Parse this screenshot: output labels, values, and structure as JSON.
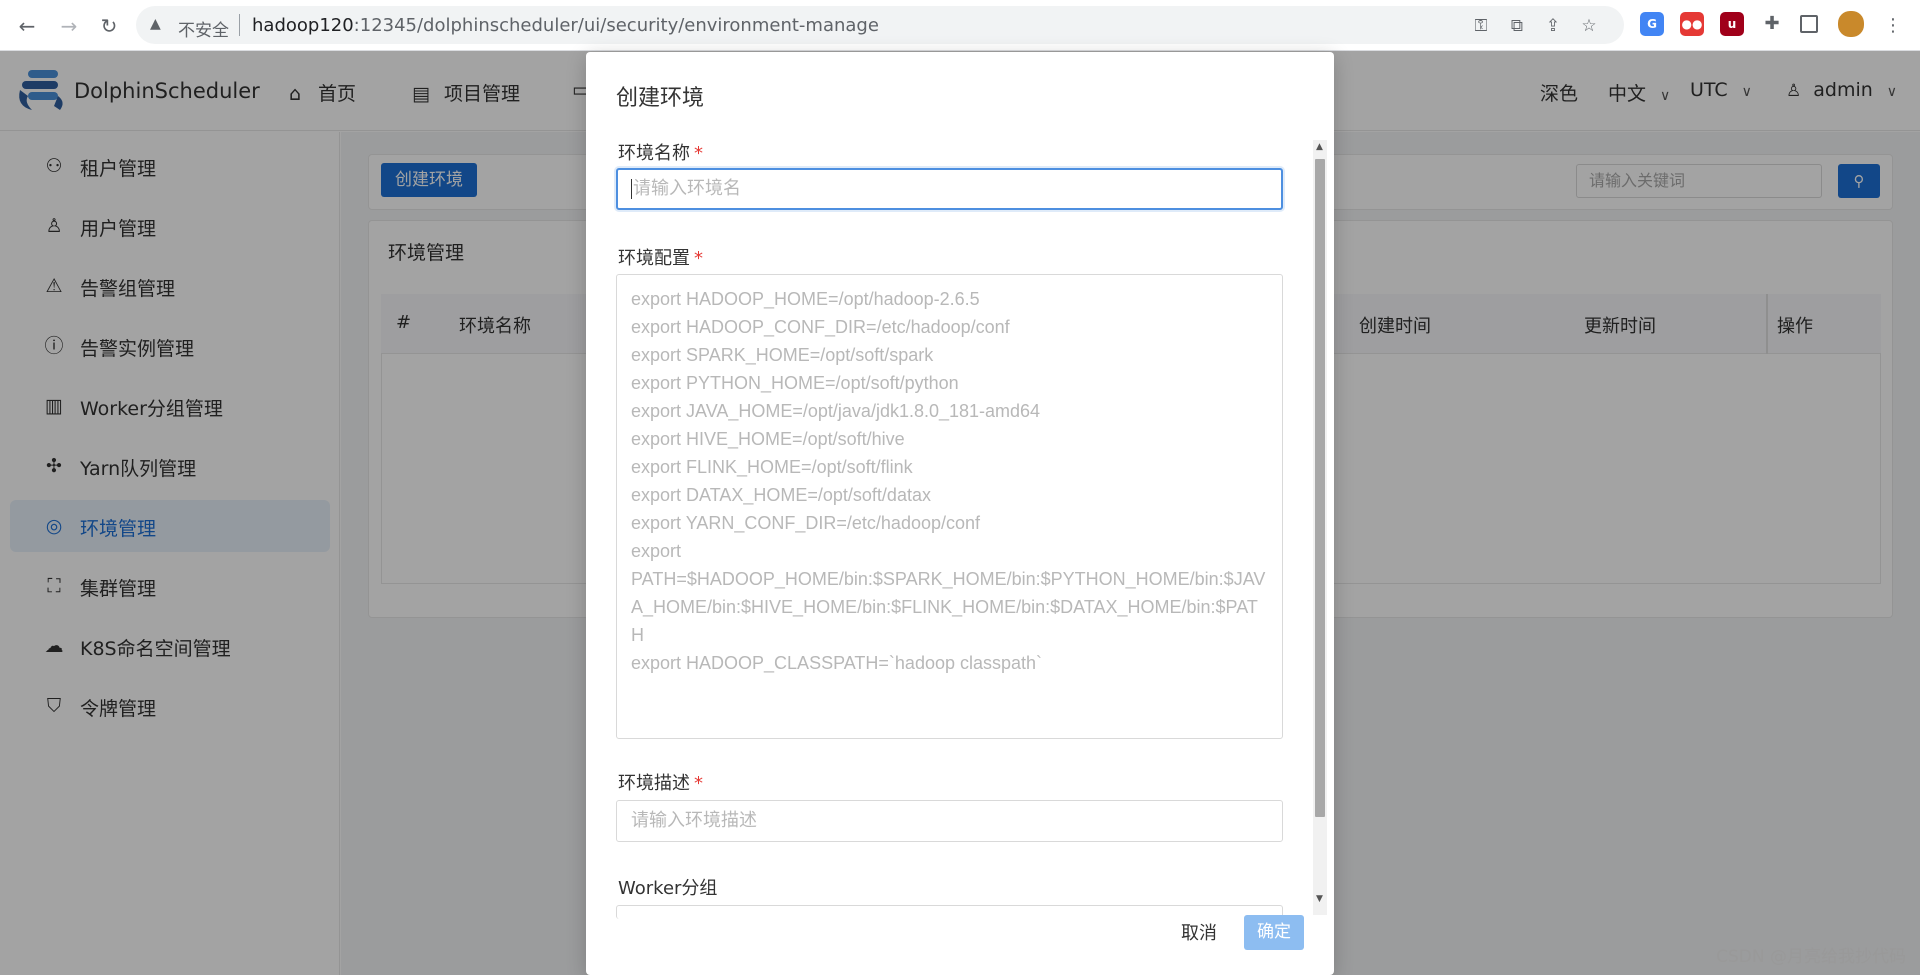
{
  "browser": {
    "back": "←",
    "forward": "→",
    "reload": "↻",
    "insecure_label": "不安全",
    "url_host": "hadoop120",
    "url_rest": ":12345/dolphinscheduler/ui/security/environment-manage"
  },
  "app": {
    "logo_text": "DolphinScheduler",
    "nav": [
      {
        "label": "首页",
        "icon": "home-icon"
      },
      {
        "label": "项目管理",
        "icon": "project-icon"
      }
    ],
    "theme_label": "深色",
    "language_label": "中文",
    "timezone_label": "UTC",
    "user_label": "admin"
  },
  "sidebar": {
    "items": [
      {
        "label": "租户管理",
        "icon": "tenant-icon",
        "active": false
      },
      {
        "label": "用户管理",
        "icon": "user-icon",
        "active": false
      },
      {
        "label": "告警组管理",
        "icon": "warning-icon",
        "active": false
      },
      {
        "label": "告警实例管理",
        "icon": "info-icon",
        "active": false
      },
      {
        "label": "Worker分组管理",
        "icon": "worker-group-icon",
        "active": false
      },
      {
        "label": "Yarn队列管理",
        "icon": "yarn-icon",
        "active": false
      },
      {
        "label": "环境管理",
        "icon": "location-icon",
        "active": true
      },
      {
        "label": "集群管理",
        "icon": "cluster-icon",
        "active": false
      },
      {
        "label": "K8S命名空间管理",
        "icon": "k8s-icon",
        "active": false
      },
      {
        "label": "令牌管理",
        "icon": "shield-icon",
        "active": false
      }
    ]
  },
  "main": {
    "create_button": "创建环境",
    "search_placeholder": "请输入关键词",
    "card_title": "环境管理",
    "table_headers": [
      "#",
      "环境名称",
      "创建时间",
      "更新时间",
      "操作"
    ]
  },
  "modal": {
    "title": "创建环境",
    "name_label": "环境名称",
    "name_placeholder": "请输入环境名",
    "config_label": "环境配置",
    "config_lines": [
      "export HADOOP_HOME=/opt/hadoop-2.6.5",
      "export HADOOP_CONF_DIR=/etc/hadoop/conf",
      "export SPARK_HOME=/opt/soft/spark",
      "export PYTHON_HOME=/opt/soft/python",
      "export JAVA_HOME=/opt/java/jdk1.8.0_181-amd64",
      "export HIVE_HOME=/opt/soft/hive",
      "export FLINK_HOME=/opt/soft/flink",
      "export DATAX_HOME=/opt/soft/datax",
      "export YARN_CONF_DIR=/etc/hadoop/conf",
      "export",
      "PATH=$HADOOP_HOME/bin:$SPARK_HOME/bin:$PYTHON_HOME/bin:$JAVA_HOME/bin:$HIVE_HOME/bin:$FLINK_HOME/bin:$DATAX_HOME/bin:$PATH",
      "export HADOOP_CLASSPATH=`hadoop classpath`"
    ],
    "desc_label": "环境描述",
    "desc_placeholder": "请输入环境描述",
    "worker_label": "Worker分组",
    "required_mark": "*",
    "cancel_label": "取消",
    "ok_label": "确定"
  },
  "watermark": "CSDN @月亮给我抄代码"
}
